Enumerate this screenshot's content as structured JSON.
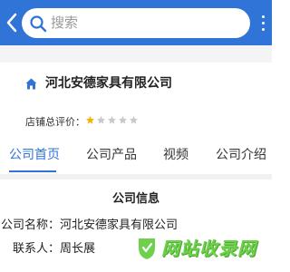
{
  "header": {
    "search_placeholder": "搜索",
    "back_icon": "chevron-left-icon",
    "search_icon": "search-icon",
    "more_icon": "more-dots-icon",
    "accent_color": "#2f74d6"
  },
  "company": {
    "name": "河北安德家具有限公司",
    "icon": "home-icon",
    "rating_label": "店铺总评价：",
    "rating": 1,
    "rating_max": 5
  },
  "tabs": [
    {
      "label": "公司首页",
      "active": true
    },
    {
      "label": "公司产品",
      "active": false
    },
    {
      "label": "视频",
      "active": false
    },
    {
      "label": "公司介绍",
      "active": false
    }
  ],
  "info": {
    "title": "公司信息",
    "rows": [
      {
        "key": "公司名称：",
        "value": "河北安德家具有限公司"
      },
      {
        "key": "联系人：",
        "value": "周长展"
      }
    ]
  },
  "watermark": {
    "text": "网站收录网"
  }
}
